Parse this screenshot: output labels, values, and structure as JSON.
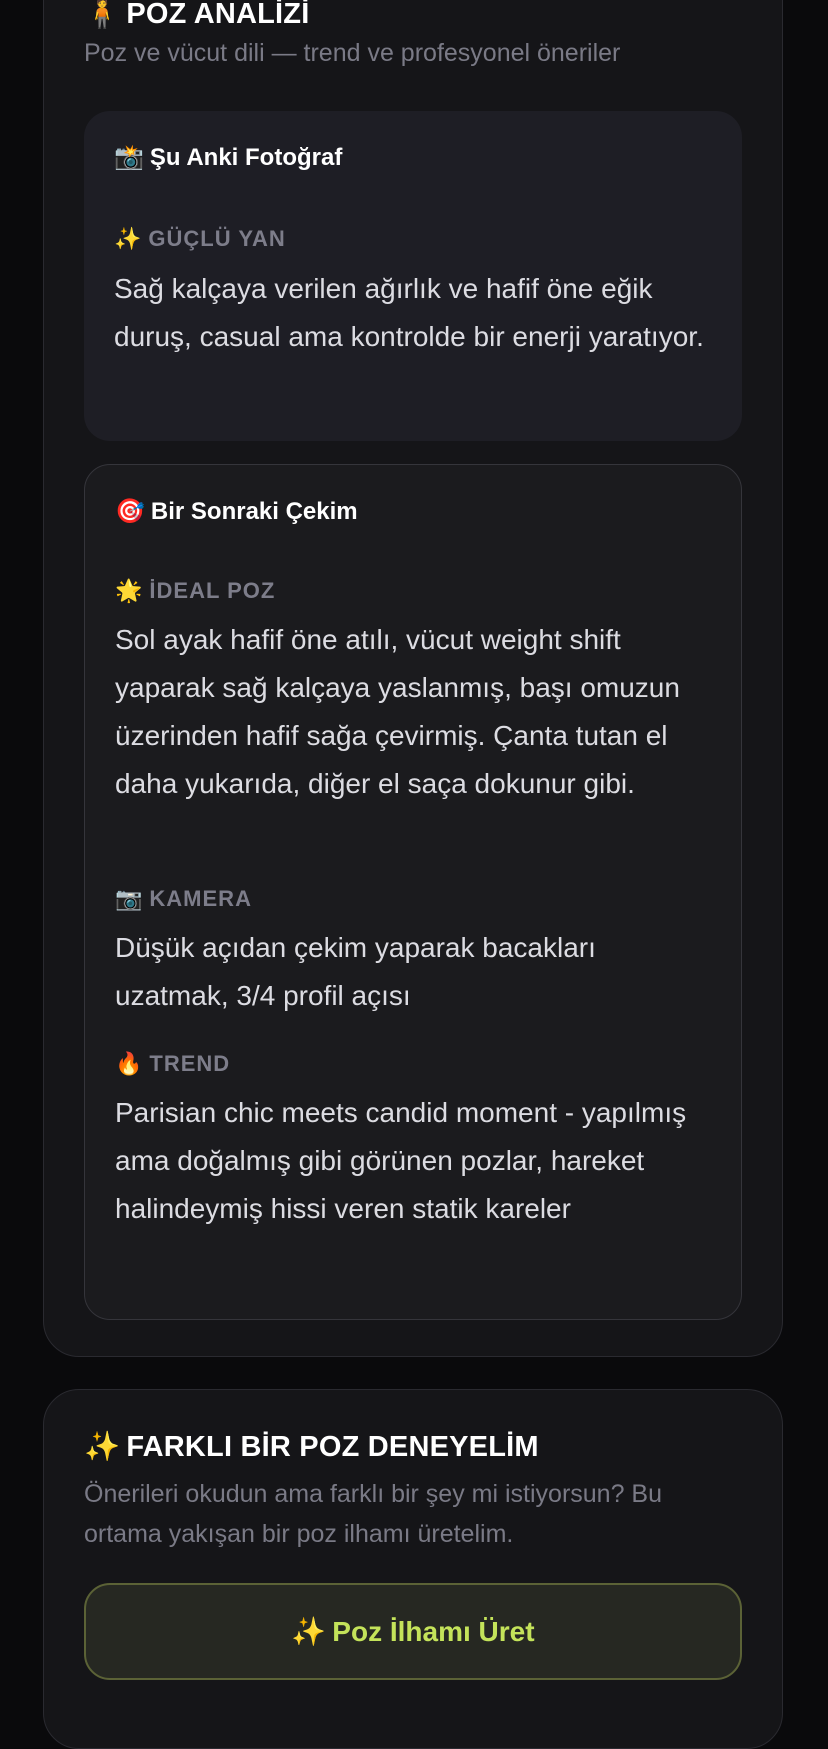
{
  "pose_panel": {
    "title": "POZ ANALİZİ",
    "title_icon": "🧍",
    "subtitle": "Poz ve vücut dili — trend ve profesyonel öneriler",
    "current": {
      "icon": "📸",
      "title": "Şu Anki Fotoğraf",
      "strength_icon": "✨",
      "strength_label": "GÜÇLÜ YAN",
      "strength_text": "Sağ kalçaya verilen ağırlık ve hafif öne eğik duruş, casual ama kontrolde bir enerji yaratıyor."
    },
    "next": {
      "icon": "🎯",
      "title": "Bir Sonraki Çekim",
      "ideal_icon": "🌟",
      "ideal_label": "İDEAL POZ",
      "ideal_text": "Sol ayak hafif öne atılı, vücut weight shift yaparak sağ kalçaya yaslanmış, başı omuzun üzerinden hafif sağa çevirmiş. Çanta tutan el daha yukarıda, diğer el saça dokunur gibi.",
      "camera_icon": "📷",
      "camera_label": "KAMERA",
      "camera_text": "Düşük açıdan çekim yaparak bacakları uzatmak, 3/4 profil açısı",
      "trend_icon": "🔥",
      "trend_label": "TREND",
      "trend_text": "Parisian chic meets candid moment - yapılmış ama doğalmış gibi görünen pozlar, hareket halindeymiş hissi veren statik kareler"
    }
  },
  "alt_panel": {
    "title_icon": "✨",
    "title": "FARKLI BİR POZ DENEYELİM",
    "subtitle": "Önerileri okudun ama farklı bir şey mi istiyorsun? Bu ortama yakışan bir poz ilhamı üretelim.",
    "button_icon": "✨",
    "button_label": "Poz İlhamı Üret"
  },
  "colors": {
    "background": "#0a0a0c",
    "panel": "#151518",
    "accent": "#c4e35a"
  }
}
